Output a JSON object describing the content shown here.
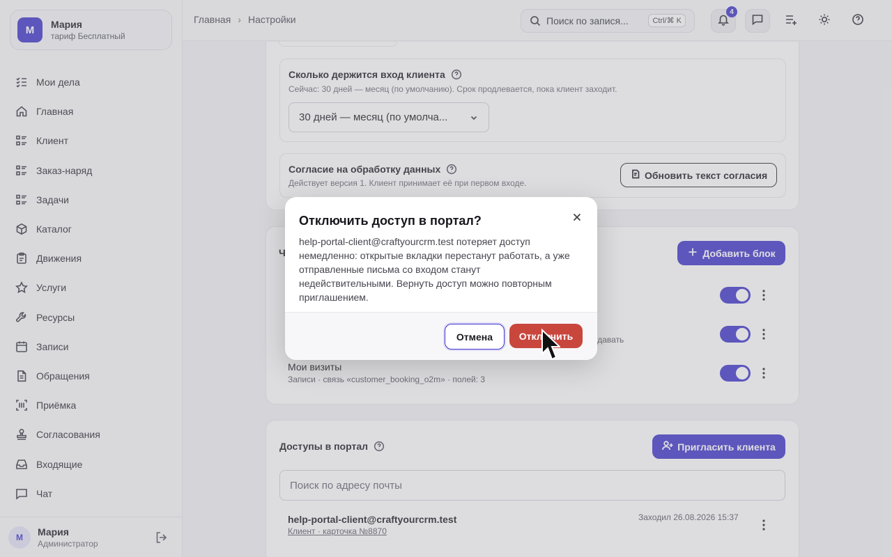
{
  "workspace": {
    "initial": "М",
    "name": "Мария",
    "plan": "тариф Бесплатный"
  },
  "nav": [
    {
      "label": "Мои дела",
      "icon": "checklist-icon"
    },
    {
      "label": "Главная",
      "icon": "home-icon"
    },
    {
      "label": "Клиент",
      "icon": "list-icon"
    },
    {
      "label": "Заказ-наряд",
      "icon": "list-icon"
    },
    {
      "label": "Задачи",
      "icon": "list-icon"
    },
    {
      "label": "Каталог",
      "icon": "box-icon"
    },
    {
      "label": "Движения",
      "icon": "clipboard-icon"
    },
    {
      "label": "Услуги",
      "icon": "star-icon"
    },
    {
      "label": "Ресурсы",
      "icon": "wrench-icon"
    },
    {
      "label": "Записи",
      "icon": "calendar-icon"
    },
    {
      "label": "Обращения",
      "icon": "document-icon"
    },
    {
      "label": "Приёмка",
      "icon": "scan-icon"
    },
    {
      "label": "Согласования",
      "icon": "stamp-icon"
    },
    {
      "label": "Входящие",
      "icon": "inbox-icon"
    },
    {
      "label": "Чат",
      "icon": "chat-icon"
    }
  ],
  "user": {
    "initial": "М",
    "name": "Мария",
    "role": "Администратор"
  },
  "breadcrumb": {
    "home": "Главная",
    "current": "Настройки"
  },
  "search": {
    "placeholder": "Поиск по запися...",
    "shortcut": "Ctrl/⌘ K"
  },
  "notifications": {
    "count": "4"
  },
  "session": {
    "title": "Сколько держится вход клиента",
    "desc": "Сейчас: 30 дней — месяц (по умолчанию). Срок продлевается, пока клиент заходит.",
    "selected": "30 дней — месяц (по умолча..."
  },
  "consent": {
    "title": "Согласие на обработку данных",
    "desc": "Действует версия 1. Клиент принимает её при первом входе.",
    "button": "Обновить текст согласия"
  },
  "blocks": {
    "title_partial": "Ч",
    "add_button": "Добавить блок",
    "row2_meta_tail": "здавать",
    "visits": {
      "title": "Мои визиты",
      "meta": "Записи  · связь «customer_booking_o2m»  · полей: 3"
    }
  },
  "access": {
    "title": "Доступы в портал",
    "invite_button": "Пригласить клиента",
    "search_placeholder": "Поиск по адресу почты",
    "row": {
      "email": "help-portal-client@craftyourcrm.test",
      "link": "Клиент · карточка №8870",
      "last_seen": "Заходил 26.08.2026 15:37"
    }
  },
  "dialog": {
    "title": "Отключить доступ в портал?",
    "body": "help-portal-client@craftyourcrm.test потеряет доступ немедленно: открытые вкладки перестанут работать, а уже отправленные письма со входом станут недействительными. Вернуть доступ можно повторным приглашением.",
    "cancel": "Отмена",
    "confirm": "Отключить"
  },
  "colors": {
    "accent": "#4338ca",
    "danger": "#c9463d"
  }
}
